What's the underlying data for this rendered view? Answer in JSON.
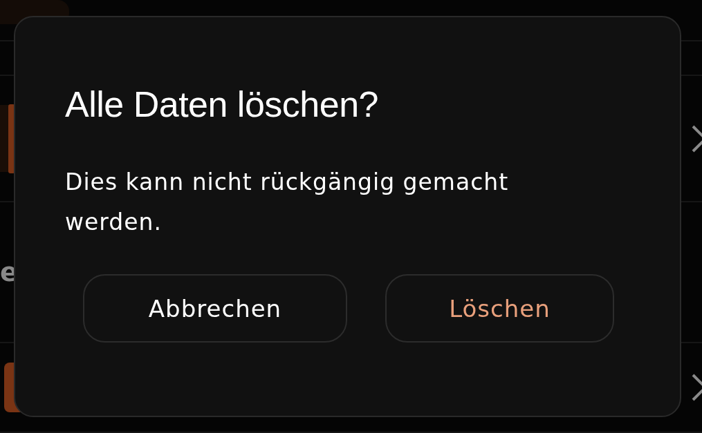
{
  "background_list": [
    {
      "kind": "tile",
      "chevron": false
    },
    {
      "kind": "blank",
      "chevron": false
    },
    {
      "kind": "tile",
      "chevron": true
    },
    {
      "kind": "label",
      "label": "e",
      "chevron": false
    },
    {
      "kind": "accent_tile",
      "chevron": true
    }
  ],
  "dialog": {
    "title": "Alle Daten löschen?",
    "message": "Dies kann nicht rückgängig gemacht werden.",
    "buttons": [
      {
        "label": "Abbrechen",
        "kind": "cancel"
      },
      {
        "label": "Löschen",
        "kind": "destructive"
      }
    ]
  }
}
